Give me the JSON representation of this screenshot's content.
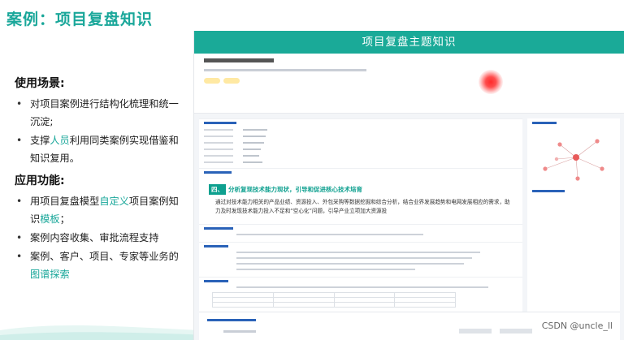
{
  "slide": {
    "title": "案例：项目复盘知识"
  },
  "usage": {
    "heading": "使用场景:",
    "items": [
      {
        "pre": "对项目案例进行结构化梳理和统一沉淀;",
        "hl": "",
        "post": ""
      },
      {
        "pre": "支撑",
        "hl": "人员",
        "post": "利用同类案例实现借鉴和知识复用。"
      }
    ]
  },
  "features": {
    "heading": "应用功能:",
    "items": [
      {
        "pre": "用项目复盘模型",
        "hl": "自定义",
        "mid": "项目案例知识",
        "hl2": "模板",
        "post": "；"
      },
      {
        "pre": "案例内容收集、审批流程支持",
        "hl": "",
        "mid": "",
        "hl2": "",
        "post": ""
      },
      {
        "pre": "案例、客户、项目、专家等业务的",
        "hl": "图谱探索",
        "mid": "",
        "hl2": "",
        "post": ""
      }
    ]
  },
  "screenshot": {
    "banner_title": "项目复盘主题知识",
    "quote_tag": "四、",
    "quote_heading": "分析复现技术能力现状，引导和促进核心技术培育",
    "quote_body": "通过对技术能力相关的产品业绩、资源投入、外包采购等数据挖掘和综合分析，结合业界发展趋势和电网发展相应的需求，助力及时发现技术能力投入不足和“空心化”问题，引导产业立项加大资源投"
  },
  "watermark": "CSDN @uncle_ll",
  "colors": {
    "accent": "#1aa79a",
    "banner": "#1aaa98",
    "alert_dot": "#ff2a2a"
  }
}
